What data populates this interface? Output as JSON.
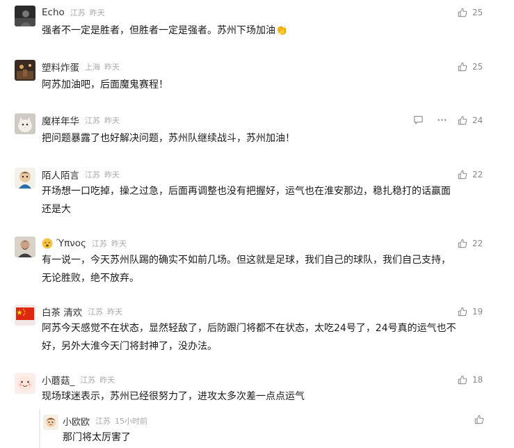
{
  "comments": [
    {
      "user": "Echo",
      "location": "江苏",
      "time": "昨天",
      "text_lines": [
        "强者不一定是胜者，但胜者一定是强者。苏州下场加油👏"
      ],
      "likes": "25",
      "avatar_icon": "user-avatar-icon"
    },
    {
      "user": "塑料炸蛋",
      "location": "上海",
      "time": "昨天",
      "text_lines": [
        "阿苏加油吧，后面魔鬼赛程！"
      ],
      "likes": "25",
      "avatar_icon": "user-avatar-icon"
    },
    {
      "user": "魔样年华",
      "location": "江苏",
      "time": "昨天",
      "text_lines": [
        "把问题暴露了也好解决问题，苏州队继续战斗，苏州加油！"
      ],
      "likes": "24",
      "avatar_icon": "cat-avatar-icon",
      "actions": [
        "reply-icon",
        "more-icon"
      ]
    },
    {
      "user": "陌人陌言",
      "location": "江苏",
      "time": "昨天",
      "text_lines": [
        "开场想一口吃掉，操之过急，后面再调整也没有把握好，运气也在淮安那边，稳扎稳打的话赢面",
        "还是大"
      ],
      "likes": "22",
      "avatar_icon": "cartoon-avatar-icon"
    },
    {
      "user": "Ύπνος",
      "location": "江苏",
      "time": "昨天",
      "text_lines": [
        "有一说一，今天苏州队踢的确实不如前几场。但这就是足球，我们自己的球队，我们自己支持，",
        "无论胜败，绝不放弃。"
      ],
      "likes": "22",
      "avatar_icon": "portrait-avatar-icon",
      "badge_icon": "sleepy-face-emoji-icon"
    },
    {
      "user": "白茶 清欢",
      "location": "江苏",
      "time": "昨天",
      "text_lines": [
        "阿苏今天感觉不在状态，显然轻敌了，后防跟门将都不在状态，太吃24号了，24号真的运气也不",
        "好，另外大淮今天门将封神了，没办法。"
      ],
      "likes": "19",
      "avatar_icon": "flag-avatar-icon"
    },
    {
      "user": "小蘑菇_",
      "location": "江苏",
      "time": "昨天",
      "text_lines": [
        "现场球迷表示，苏州已经很努力了，进攻太多次差一点点运气"
      ],
      "likes": "18",
      "avatar_icon": "smile-avatar-icon"
    }
  ],
  "reply": {
    "user": "小欧欧",
    "location": "江苏",
    "time": "15小时前",
    "text": "那门将太厉害了",
    "avatar_icon": "cartoon-avatar-icon"
  },
  "colors": {
    "meta_gray": "#a8a8a8",
    "like_gray": "#888888",
    "text": "#1a1a1a"
  }
}
